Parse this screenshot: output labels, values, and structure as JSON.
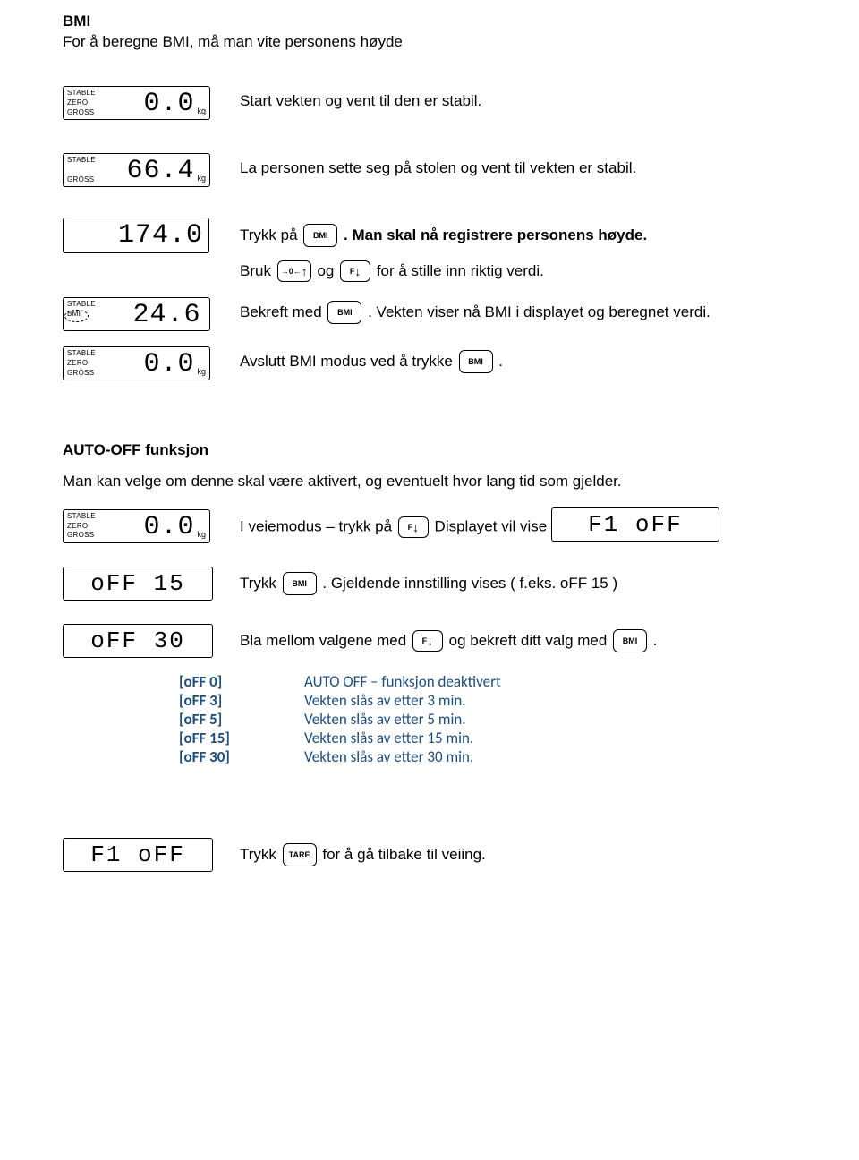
{
  "title": "BMI",
  "intro": "For å beregne BMI, må man vite personens høyde",
  "displays": {
    "d1": {
      "stable": "STABLE",
      "zero": "ZERO",
      "gross": "GROSS",
      "value": "0.0",
      "unit": "kg"
    },
    "d2": {
      "stable": "STABLE",
      "gross": "GROSS",
      "value": "66.4",
      "unit": "kg"
    },
    "d3": {
      "value": "174.0"
    },
    "d4": {
      "stable": "STABLE",
      "bmi": "BMI",
      "value": "24.6"
    },
    "d5": {
      "stable": "STABLE",
      "zero": "ZERO",
      "gross": "GROSS",
      "value": "0.0",
      "unit": "kg"
    },
    "d6": {
      "stable": "STABLE",
      "zero": "ZERO",
      "gross": "GROSS",
      "value": "0.0",
      "unit": "kg"
    },
    "d7": {
      "value": "oFF 15"
    },
    "d8": {
      "value": "oFF 30"
    },
    "d9": {
      "value": "F1 oFF"
    },
    "d10": {
      "value": "F1 oFF"
    }
  },
  "keys": {
    "bmi": "BMI",
    "zero": "→0←",
    "f": "F",
    "tare": "TARE"
  },
  "steps": {
    "s1": "Start vekten og vent til den er stabil.",
    "s2": "La personen sette seg på stolen og vent til vekten er stabil.",
    "s3a": "Trykk på ",
    "s3b": ". Man skal nå registrere personens høyde.",
    "s4a": "Bruk ",
    "s4b": " og ",
    "s4c": " for å stille inn riktig verdi.",
    "s5a": "Bekreft med ",
    "s5b": ". Vekten viser nå BMI i displayet og beregnet verdi.",
    "s6a": "Avslutt BMI modus ved å trykke ",
    "s6b": "."
  },
  "autooff": {
    "title": "AUTO-OFF funksjon",
    "intro": "Man kan velge om denne skal være aktivert, og eventuelt hvor lang tid som gjelder.",
    "r1a": "I veiemodus – trykk på ",
    "r1b": " Displayet vil vise ",
    "r2a": "Trykk ",
    "r2b": ". Gjeldende innstilling vises ( f.eks. oFF 15 )",
    "r3a": "Bla mellom valgene med ",
    "r3b": " og bekreft ditt valg med ",
    "r3c": ".",
    "table": [
      {
        "k": "[oFF 0]",
        "v": "AUTO OFF – funksjon deaktivert"
      },
      {
        "k": "[oFF 3]",
        "v": "Vekten slås av etter 3 min."
      },
      {
        "k": "[oFF 5]",
        "v": "Vekten slås av etter 5 min."
      },
      {
        "k": "[oFF 15]",
        "v": "Vekten slås av etter 15 min."
      },
      {
        "k": "[oFF 30]",
        "v": "Vekten slås av etter 30 min."
      }
    ],
    "final_a": "Trykk ",
    "final_b": " for å gå tilbake til veiing."
  }
}
